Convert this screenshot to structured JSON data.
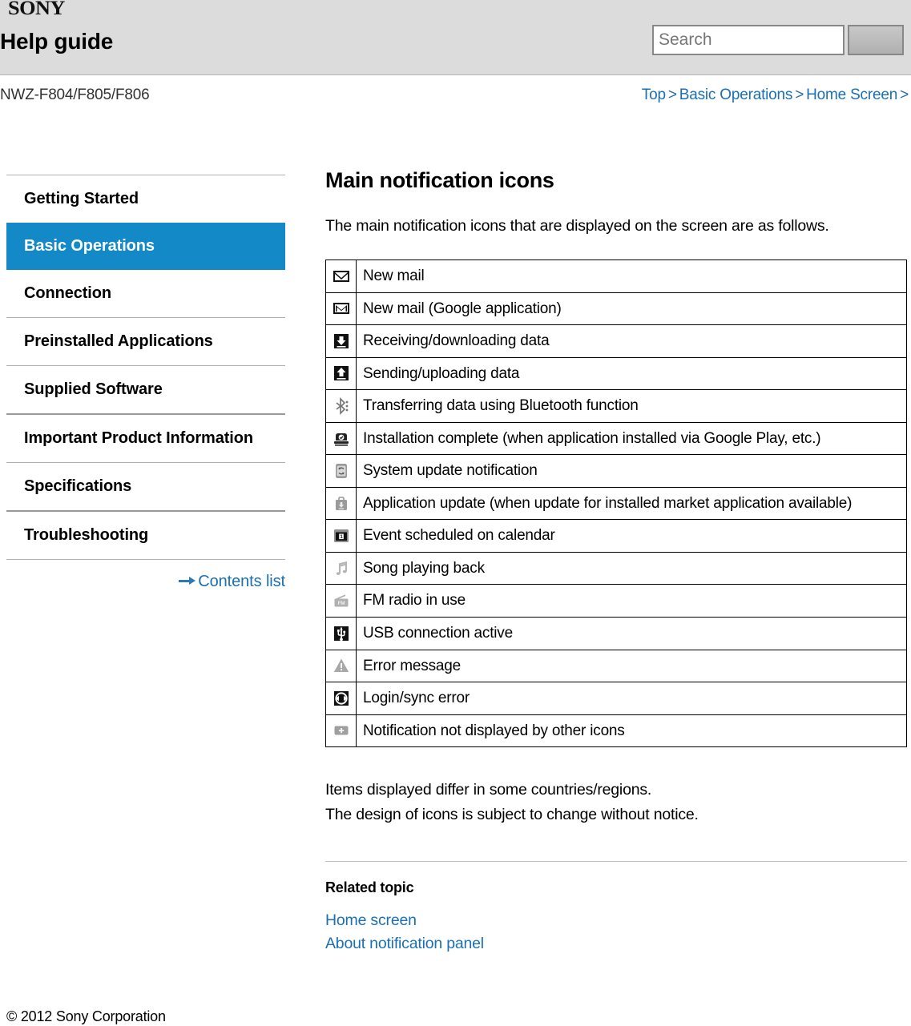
{
  "header": {
    "brand": "SONY",
    "title": "Help guide",
    "search": {
      "placeholder": "Search",
      "value": "",
      "button_label": ""
    }
  },
  "breadcrumb_bar": {
    "model": "NWZ-F804/F805/F806",
    "items": [
      "Top",
      "Basic Operations",
      "Home Screen"
    ],
    "separator": ">",
    "trailing_separator": ">"
  },
  "sidebar": {
    "items": [
      {
        "label": "Getting Started",
        "active": false
      },
      {
        "label": "Basic Operations",
        "active": true
      },
      {
        "label": "Connection",
        "active": false
      },
      {
        "label": "Preinstalled Applications",
        "active": false
      },
      {
        "label": "Supplied Software",
        "active": false
      },
      {
        "label": "Important Product Information",
        "active": false
      },
      {
        "label": "Specifications",
        "active": false
      },
      {
        "label": "Troubleshooting",
        "active": false
      }
    ],
    "contents_list_label": "Contents list",
    "contents_list_icon": "arrow-right-icon"
  },
  "main": {
    "title": "Main notification icons",
    "intro": "The main notification icons that are displayed on the screen are as follows.",
    "table_rows": [
      {
        "icon": "envelope-icon",
        "desc": "New mail"
      },
      {
        "icon": "gmail-envelope-icon",
        "desc": "New mail (Google application)"
      },
      {
        "icon": "download-arrow-icon",
        "desc": "Receiving/downloading data"
      },
      {
        "icon": "upload-arrow-icon",
        "desc": "Sending/uploading data"
      },
      {
        "icon": "bluetooth-transfer-icon",
        "desc": "Transferring data using Bluetooth function"
      },
      {
        "icon": "install-complete-icon",
        "desc": "Installation complete (when application installed via Google Play, etc.)"
      },
      {
        "icon": "system-update-icon",
        "desc": "System update notification"
      },
      {
        "icon": "app-update-bag-icon",
        "desc": "Application update (when update for installed market application available)"
      },
      {
        "icon": "calendar-event-icon",
        "desc": "Event scheduled on calendar"
      },
      {
        "icon": "music-note-icon",
        "desc": "Song playing back"
      },
      {
        "icon": "fm-radio-icon",
        "desc": "FM radio in use"
      },
      {
        "icon": "usb-icon",
        "desc": "USB connection active"
      },
      {
        "icon": "warning-triangle-icon",
        "desc": "Error message"
      },
      {
        "icon": "sync-error-icon",
        "desc": "Login/sync error"
      },
      {
        "icon": "plus-badge-icon",
        "desc": "Notification not displayed by other icons"
      }
    ],
    "notes": [
      "Items displayed differ in some countries/regions.",
      "The design of icons is subject to change without notice."
    ],
    "related_title": "Related topic",
    "related_links": [
      "Home screen",
      "About notification panel"
    ]
  },
  "footer": {
    "copyright": "© 2012 Sony Corporation"
  },
  "colors": {
    "accent_blue": "#1489c8",
    "link_blue": "#1a6fb5",
    "header_bg": "#dcdcdc"
  }
}
